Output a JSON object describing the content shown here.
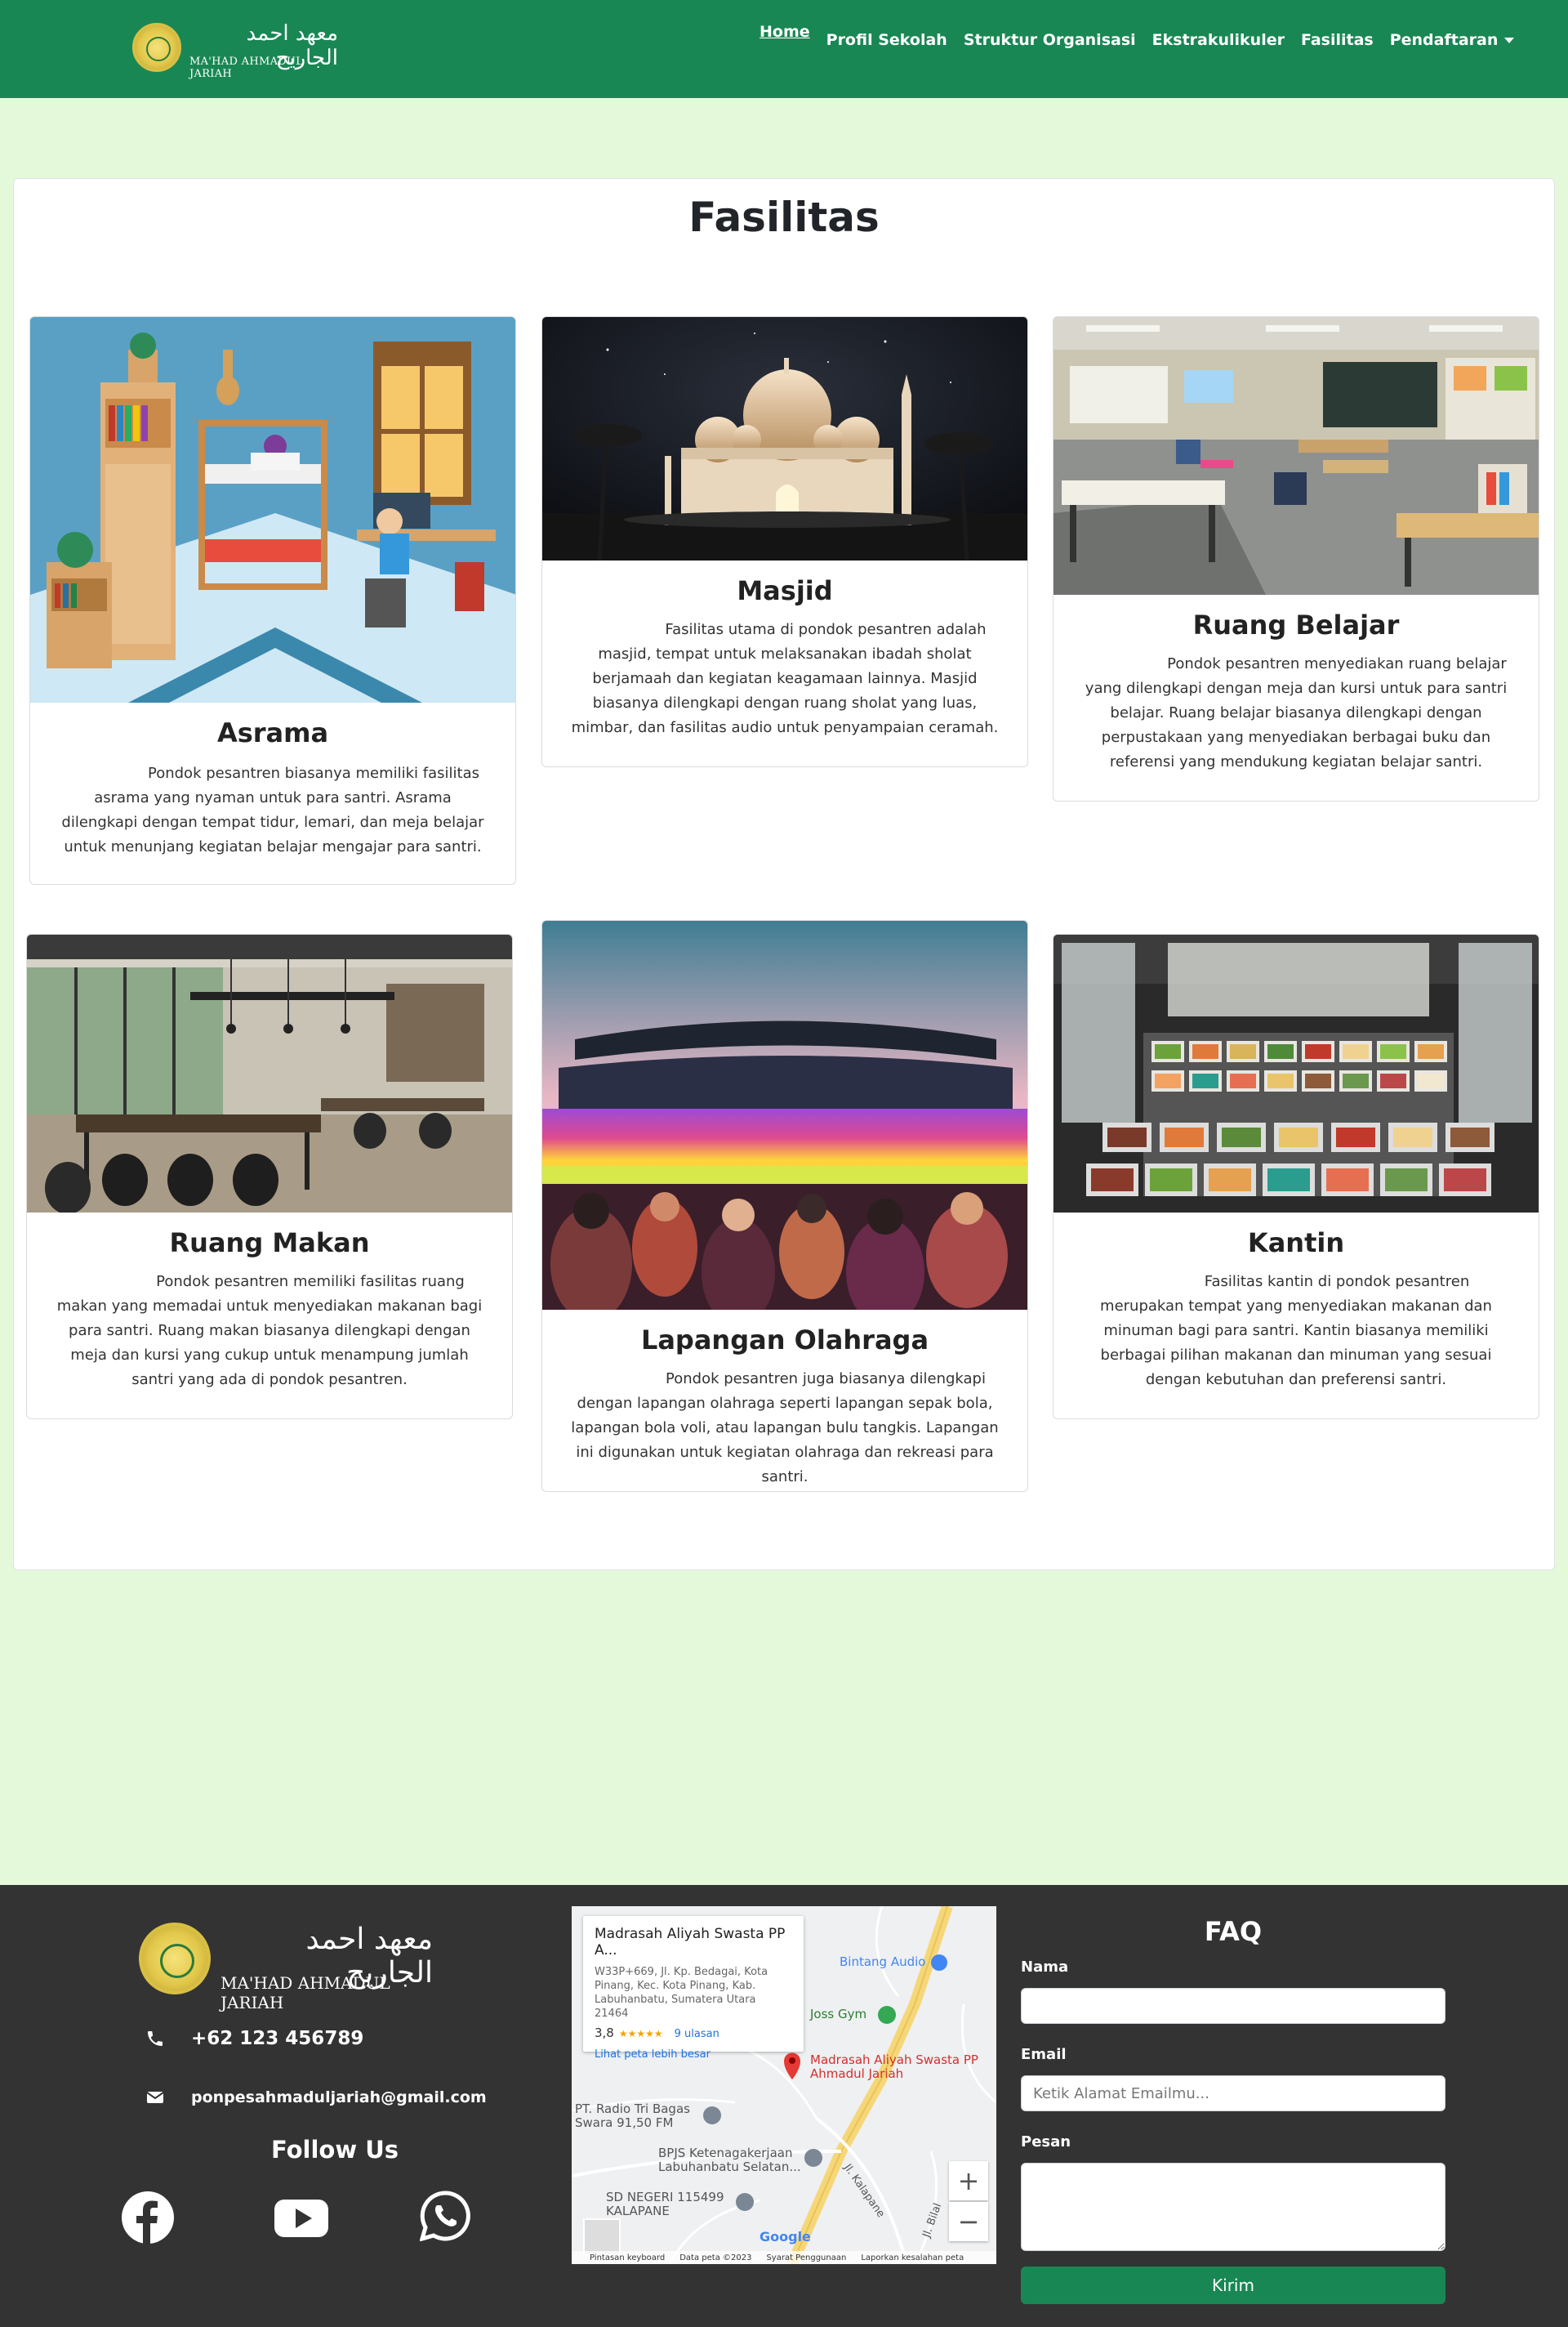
{
  "navbar": {
    "brand_arabic": "معهد احمد الجاريح",
    "brand_latin": "MA'HAD AHMADUL JARIAH",
    "items": [
      {
        "label": "Home",
        "active": true
      },
      {
        "label": "Profil Sekolah"
      },
      {
        "label": "Struktur Organisasi"
      },
      {
        "label": "Ekstrakulikuler"
      },
      {
        "label": "Fasilitas"
      },
      {
        "label": "Pendaftaran",
        "dropdown": true
      }
    ]
  },
  "page": {
    "title": "Fasilitas"
  },
  "facilities": [
    {
      "title": "Asrama",
      "desc": "Pondok pesantren biasanya memiliki fasilitas asrama yang nyaman untuk para santri. Asrama dilengkapi dengan tempat tidur, lemari, dan meja belajar untuk menunjang kegiatan belajar mengajar para santri."
    },
    {
      "title": "Masjid",
      "desc": "Fasilitas utama di pondok pesantren adalah masjid, tempat untuk melaksanakan ibadah sholat berjamaah dan kegiatan keagamaan lainnya. Masjid biasanya dilengkapi dengan ruang sholat yang luas, mimbar, dan fasilitas audio untuk penyampaian ceramah."
    },
    {
      "title": "Ruang Belajar",
      "desc": "Pondok pesantren menyediakan ruang belajar yang dilengkapi dengan meja dan kursi untuk para santri belajar. Ruang belajar biasanya dilengkapi dengan perpustakaan yang menyediakan berbagai buku dan referensi yang mendukung kegiatan belajar santri."
    },
    {
      "title": "Ruang Makan",
      "desc": "Pondok pesantren memiliki fasilitas ruang makan yang memadai untuk menyediakan makanan bagi para santri. Ruang makan biasanya dilengkapi dengan meja dan kursi yang cukup untuk menampung jumlah santri yang ada di pondok pesantren."
    },
    {
      "title": "Lapangan Olahraga",
      "desc": "Pondok pesantren juga biasanya dilengkapi dengan lapangan olahraga seperti lapangan sepak bola, lapangan bola voli, atau lapangan bulu tangkis. Lapangan ini digunakan untuk kegiatan olahraga dan rekreasi para santri."
    },
    {
      "title": "Kantin",
      "desc": "Fasilitas kantin di pondok pesantren merupakan tempat yang menyediakan makanan dan minuman bagi para santri. Kantin biasanya memiliki berbagai pilihan makanan dan minuman yang sesuai dengan kebutuhan dan preferensi santri."
    }
  ],
  "footer": {
    "brand_arabic": "معهد احمد الجاريح",
    "brand_latin": "MA'HAD AHMADUL JARIAH",
    "phone": "+62 123 456789",
    "email": "ponpesahmaduljariah@gmail.com",
    "follow_title": "Follow Us",
    "social_icons": [
      "facebook-icon",
      "youtube-icon",
      "whatsapp-icon"
    ],
    "map": {
      "place_name": "Madrasah Aliyah Swasta PP A...",
      "address": "W33P+669, Jl. Kp. Bedagai, Kota Pinang, Kec. Kota Pinang, Kab. Labuhanbatu, Sumatera Utara 21464",
      "rating": "3,8",
      "stars": "★★★★★",
      "reviews": "9 ulasan",
      "larger_map": "Lihat peta lebih besar",
      "pin_label": "Madrasah Aliyah Swasta PP Ahmadul Jariah",
      "poi_bintang": "Bintang Audio",
      "poi_joss": "Joss Gym",
      "poi_radio": "PT. Radio Tri Bagas Swara 91,50 FM",
      "poi_bpjs": "BPJS Ketenagakerjaan Labuhanbatu Selatan...",
      "poi_sd": "SD NEGERI 115499 KALAPANE",
      "road_kalapane": "Jl. Kalapane",
      "road_bilal": "Jl. Bilal",
      "google": "Google",
      "zoom_in": "+",
      "zoom_out": "−",
      "bottom": [
        "Pintasan keyboard",
        "Data peta ©2023",
        "Syarat Penggunaan",
        "Laporkan kesalahan peta"
      ]
    },
    "faq": {
      "title": "FAQ",
      "name_label": "Nama",
      "name_value": "",
      "email_label": "Email",
      "email_placeholder": "Ketik Alamat Emailmu...",
      "message_label": "Pesan",
      "message_value": "",
      "submit": "Kirim"
    }
  },
  "colors": {
    "navbar": "#198754",
    "page_bg": "#e4f9da",
    "footer_bg": "#333333",
    "button": "#198754"
  }
}
